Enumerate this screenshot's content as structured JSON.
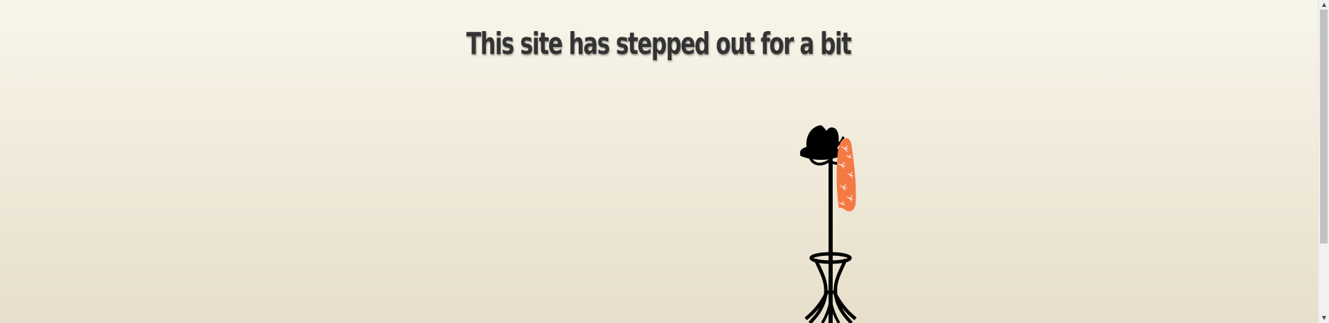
{
  "page": {
    "headline": "This site has stepped out for a bit"
  },
  "illustration": {
    "icon": "coat-rack-with-hat-and-hawaiian-shirt",
    "colors": {
      "rack": "#000000",
      "shirt": "#f47a45",
      "background_top": "#f8f5ea",
      "background_bottom": "#e7dfcb"
    }
  },
  "scrollbar": {
    "up_arrow": "▲",
    "down_arrow": "▼"
  }
}
